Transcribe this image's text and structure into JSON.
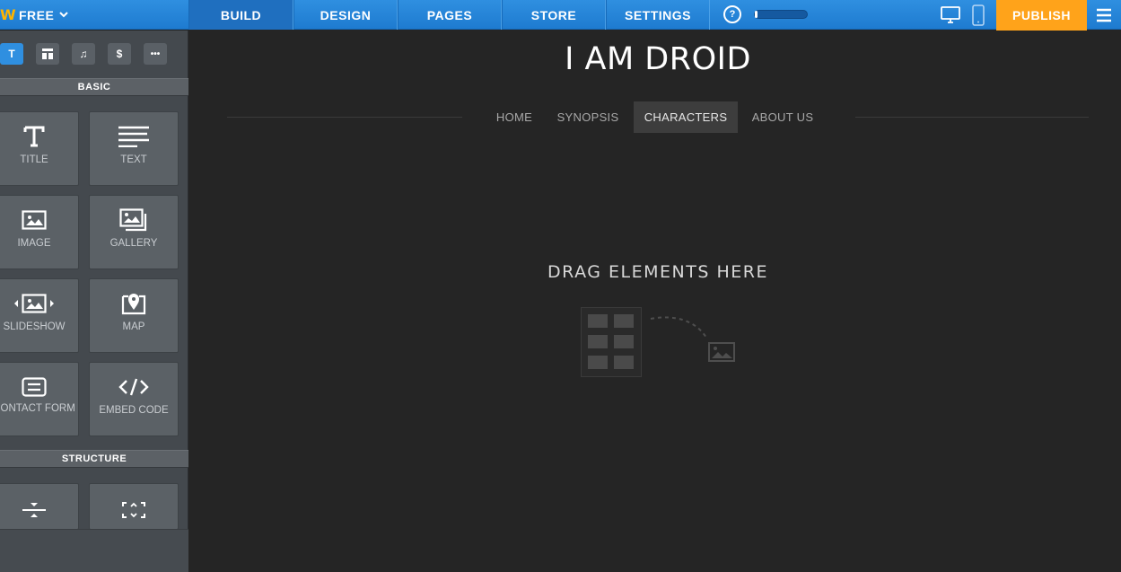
{
  "brand": {
    "logo_letter": "W",
    "plan_label": "FREE"
  },
  "nav": {
    "tabs": [
      {
        "label": "BUILD",
        "active": true
      },
      {
        "label": "DESIGN",
        "active": false
      },
      {
        "label": "PAGES",
        "active": false
      },
      {
        "label": "STORE",
        "active": false
      },
      {
        "label": "SETTINGS",
        "active": false
      }
    ],
    "help_glyph": "?",
    "progress_fraction": 0.06,
    "publish_label": "PUBLISH"
  },
  "sidebar": {
    "categories": [
      {
        "glyph": "T",
        "icon": "text-category-icon",
        "active": true
      },
      {
        "glyph": "",
        "icon": "layout-category-icon",
        "active": false
      },
      {
        "glyph": "♫",
        "icon": "music-category-icon",
        "active": false
      },
      {
        "glyph": "$",
        "icon": "store-category-icon",
        "active": false
      },
      {
        "glyph": "•••",
        "icon": "more-category-icon",
        "active": false
      }
    ],
    "basic_label": "BASIC",
    "basic_items": [
      {
        "label": "TITLE",
        "icon": "title-icon"
      },
      {
        "label": "TEXT",
        "icon": "text-icon"
      },
      {
        "label": "IMAGE",
        "icon": "image-icon"
      },
      {
        "label": "GALLERY",
        "icon": "gallery-icon"
      },
      {
        "label": "SLIDESHOW",
        "icon": "slideshow-icon"
      },
      {
        "label": "MAP",
        "icon": "map-icon"
      },
      {
        "label": "CONTACT FORM",
        "icon": "contact-form-icon"
      },
      {
        "label": "EMBED CODE",
        "icon": "embed-code-icon"
      }
    ],
    "structure_label": "STRUCTURE",
    "structure_items": [
      {
        "label": "",
        "icon": "divider-icon"
      },
      {
        "label": "",
        "icon": "spacer-icon"
      }
    ]
  },
  "site": {
    "title": "I AM DROID",
    "nav": [
      {
        "label": "HOME",
        "active": false
      },
      {
        "label": "SYNOPSIS",
        "active": false
      },
      {
        "label": "CHARACTERS",
        "active": true
      },
      {
        "label": "ABOUT US",
        "active": false
      }
    ],
    "drop_label": "DRAG ELEMENTS HERE"
  },
  "colors": {
    "topbar": "#2284d8",
    "publish": "#ffa31a",
    "sidebar": "#44494e",
    "canvas": "#252525",
    "accent": "#2f8fe0"
  }
}
